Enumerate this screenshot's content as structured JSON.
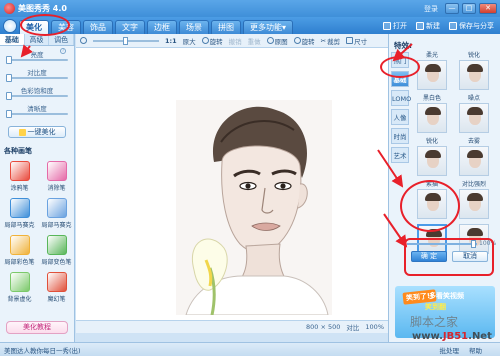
{
  "window": {
    "title": "美图秀秀 4.0",
    "login": "登录",
    "minimize": "—",
    "maximize": "□",
    "close": "✕"
  },
  "tabs": [
    {
      "label": "美化"
    },
    {
      "label": "美容"
    },
    {
      "label": "饰品"
    },
    {
      "label": "文字"
    },
    {
      "label": "边框"
    },
    {
      "label": "场景"
    },
    {
      "label": "拼图"
    },
    {
      "label": "更多功能▾"
    }
  ],
  "top_tools": {
    "open": "打开",
    "new": "新建",
    "save": "保存与分享"
  },
  "left": {
    "subtabs": [
      "基础",
      "高级",
      "调色"
    ],
    "sliders": [
      {
        "label": "亮度",
        "value": 0
      },
      {
        "label": "对比度",
        "value": 0
      },
      {
        "label": "色彩饱和度",
        "value": 0
      },
      {
        "label": "清晰度",
        "value": 0
      }
    ],
    "auto_button": "一键美化",
    "brushes_title": "各种画笔",
    "brushes": [
      {
        "label": "涂鸦笔",
        "icon": "doodle-pen-icon",
        "color": "#e94a3c"
      },
      {
        "label": "消除笔",
        "icon": "eraser-pen-icon",
        "color": "#e56aa8"
      },
      {
        "label": "局部马赛克",
        "icon": "mosaic-icon",
        "color": "#3f8fd9"
      },
      {
        "label": "局部马赛克",
        "icon": "mosaic-icon",
        "color": "#6aa2e0"
      },
      {
        "label": "局部彩色笔",
        "icon": "color-brush-icon",
        "color": "#f0b23a"
      },
      {
        "label": "局部变色笔",
        "icon": "recolor-brush-icon",
        "color": "#58b65a"
      },
      {
        "label": "背景虚化",
        "icon": "blur-bg-icon",
        "color": "#7bc96a"
      },
      {
        "label": "魔幻笔",
        "icon": "magic-pen-icon",
        "color": "#e0503a"
      }
    ],
    "tutorial_button": "美化教程"
  },
  "toolbar": {
    "ratio": "1:1",
    "original": "原大",
    "rotate": "旋转",
    "back": "撤销",
    "redo": "重做",
    "compare": "原图",
    "crop": "旋转",
    "cut": "裁剪",
    "size": "尺寸"
  },
  "status": {
    "size": "800 × 500",
    "compare": "对比",
    "zoom": "100%"
  },
  "right": {
    "title": "特效:",
    "categories": [
      "热门",
      "基础",
      "LOMO",
      "人像",
      "时尚",
      "艺术"
    ],
    "effects": [
      {
        "label": "柔光"
      },
      {
        "label": "锐化"
      },
      {
        "label": "黑白色"
      },
      {
        "label": "噪点"
      },
      {
        "label": "锐化"
      },
      {
        "label": "去雾"
      },
      {
        "label": "素描"
      },
      {
        "label": "对比强烈"
      },
      {
        "label": "智能绘色"
      },
      {
        "label": "全彩"
      }
    ],
    "opacity_value": "100%",
    "ok_button": "确 定",
    "cancel_button": "取消",
    "ad": {
      "badge": "笑到了!!",
      "line1": "多看笑视频",
      "line2": "笑到翻"
    }
  },
  "bottombar": {
    "left": "美图达人教你每日一秀(出)",
    "right1": "批处理",
    "right2": "帮助"
  },
  "watermark": {
    "cn": "脚本之家",
    "url_prefix": "www.",
    "url_brand": "JB51",
    "url_suffix": ".Net"
  },
  "colors": {
    "accent": "#3f8fd9",
    "annotation": "#e8202a"
  }
}
